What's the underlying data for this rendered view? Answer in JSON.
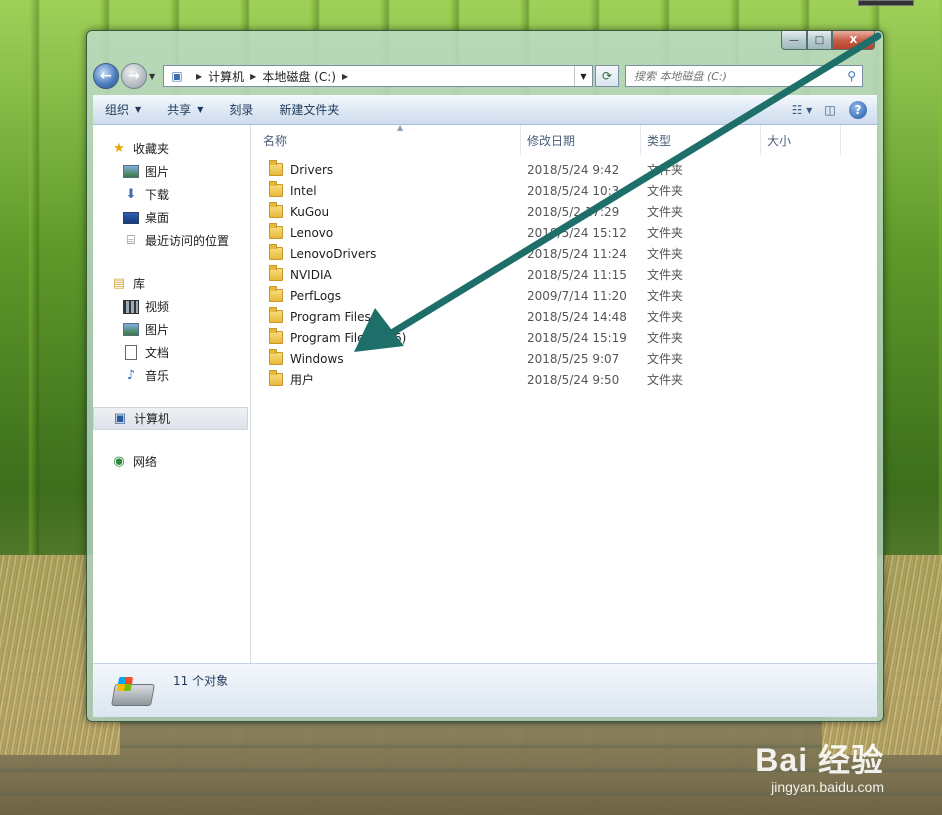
{
  "window": {
    "caption": {
      "minimize": "—",
      "maximize": "□",
      "close": "X"
    }
  },
  "nav": {
    "back_icon": "←",
    "forward_icon": "→",
    "breadcrumb": [
      "计算机",
      "本地磁盘 (C:)"
    ],
    "search_placeholder": "搜索 本地磁盘 (C:)"
  },
  "toolbar": {
    "organize": "组织",
    "share": "共享",
    "burn": "刻录",
    "new_folder": "新建文件夹"
  },
  "sidebar": {
    "favorites": {
      "label": "收藏夹",
      "items": [
        "图片",
        "下载",
        "桌面",
        "最近访问的位置"
      ]
    },
    "libraries": {
      "label": "库",
      "items": [
        "视频",
        "图片",
        "文档",
        "音乐"
      ]
    },
    "computer": "计算机",
    "network": "网络"
  },
  "columns": {
    "name": "名称",
    "modified": "修改日期",
    "type": "类型",
    "size": "大小"
  },
  "files": [
    {
      "name": "Drivers",
      "modified": "2018/5/24 9:42",
      "type": "文件夹"
    },
    {
      "name": "Intel",
      "modified": "2018/5/24 10:3",
      "type": "文件夹"
    },
    {
      "name": "KuGou",
      "modified": "2018/5/2 17:29",
      "type": "文件夹"
    },
    {
      "name": "Lenovo",
      "modified": "2018/5/24 15:12",
      "type": "文件夹"
    },
    {
      "name": "LenovoDrivers",
      "modified": "2018/5/24 11:24",
      "type": "文件夹"
    },
    {
      "name": "NVIDIA",
      "modified": "2018/5/24 11:15",
      "type": "文件夹"
    },
    {
      "name": "PerfLogs",
      "modified": "2009/7/14 11:20",
      "type": "文件夹"
    },
    {
      "name": "Program Files",
      "modified": "2018/5/24 14:48",
      "type": "文件夹"
    },
    {
      "name": "Program Files (x86)",
      "modified": "2018/5/24 15:19",
      "type": "文件夹"
    },
    {
      "name": "Windows",
      "modified": "2018/5/25 9:07",
      "type": "文件夹"
    },
    {
      "name": "用户",
      "modified": "2018/5/24 9:50",
      "type": "文件夹"
    }
  ],
  "status": {
    "count_text": "11 个对象"
  },
  "watermark": {
    "main": "Bai 经验",
    "sub": "jingyan.baidu.com"
  },
  "colors": {
    "annotation_arrow": "#1e6e6a"
  }
}
